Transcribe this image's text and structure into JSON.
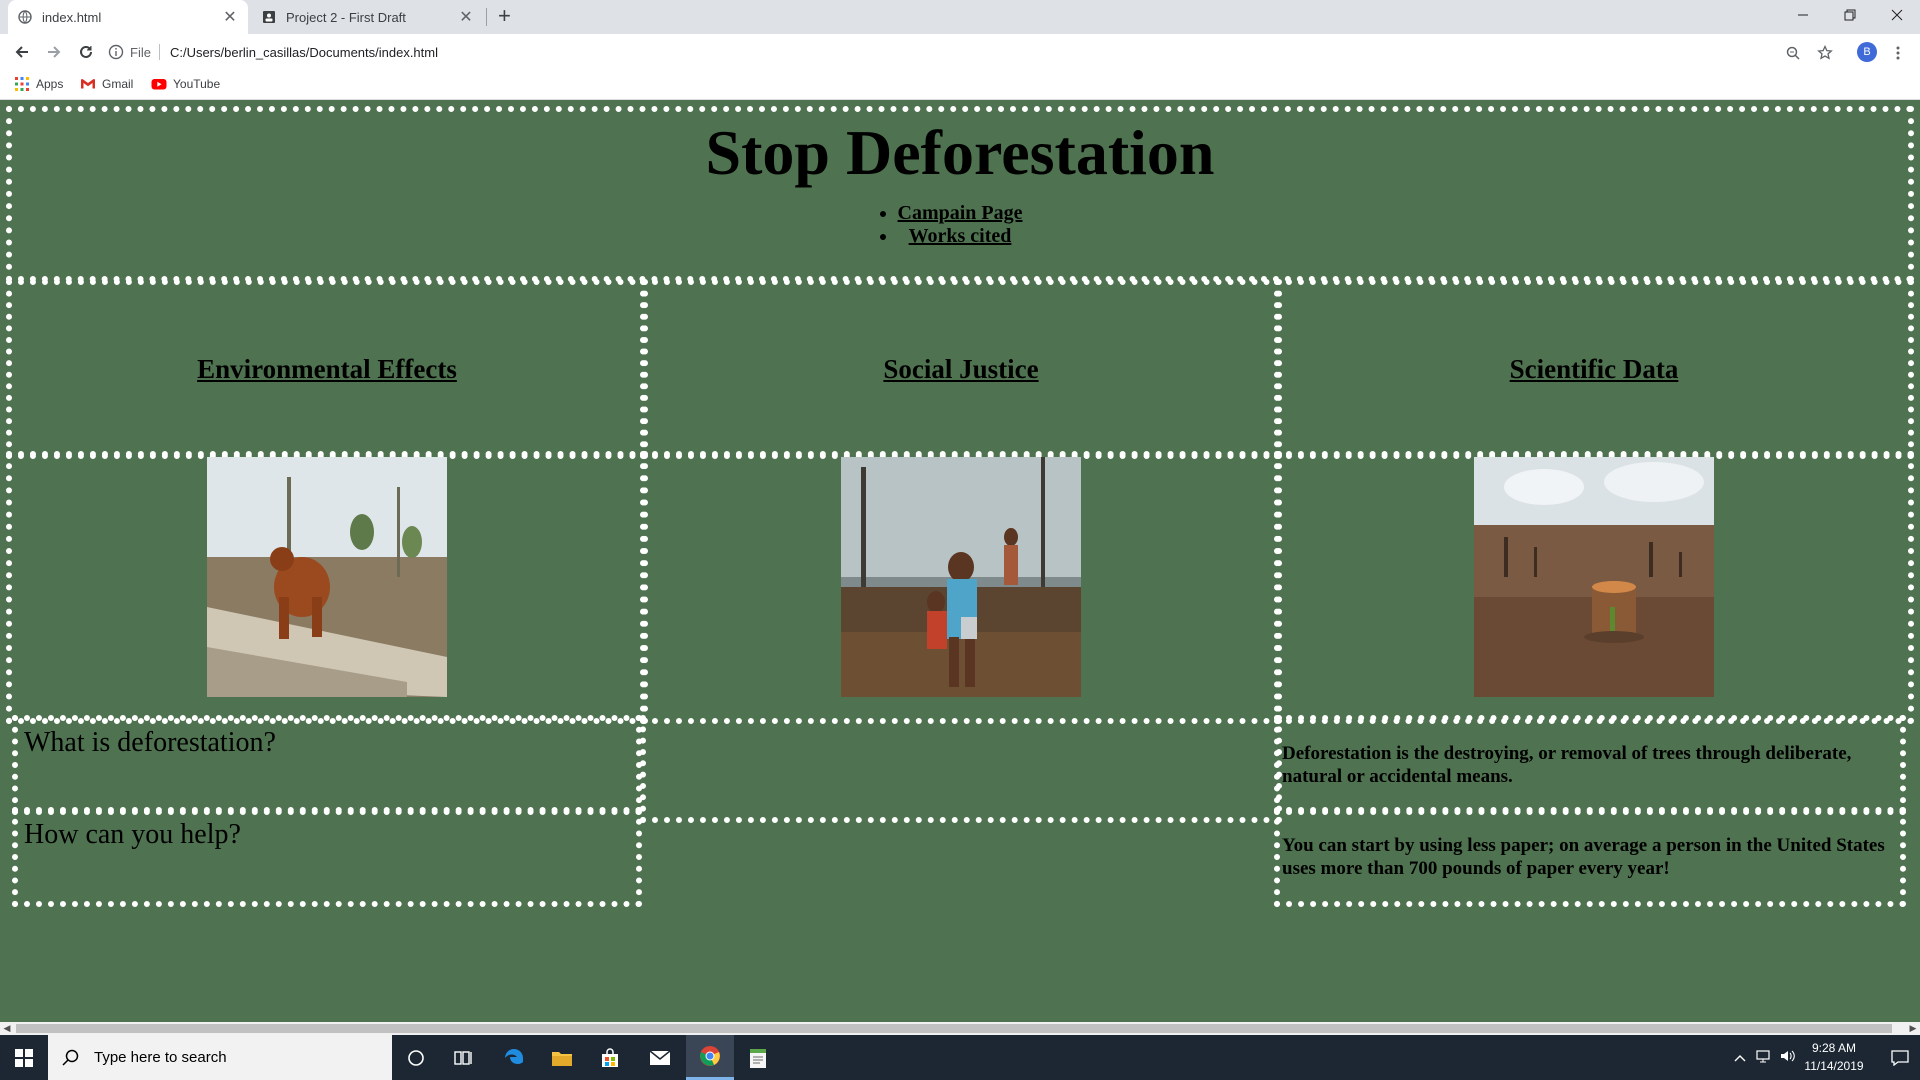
{
  "browser": {
    "tabs": [
      {
        "title": "index.html",
        "active": true
      },
      {
        "title": "Project 2 - First Draft",
        "active": false
      }
    ],
    "address": {
      "scheme": "File",
      "url": "C:/Users/berlin_casillas/Documents/index.html"
    },
    "profile_initial": "B",
    "bookmarks": [
      {
        "label": "Apps",
        "icon": "apps-grid-icon"
      },
      {
        "label": "Gmail",
        "icon": "gmail-icon"
      },
      {
        "label": "YouTube",
        "icon": "youtube-icon"
      }
    ]
  },
  "page": {
    "title": "Stop Deforestation",
    "nav_links": [
      "Campain Page",
      "Works cited"
    ],
    "sections": [
      {
        "heading": "Environmental Effects",
        "image": "orangutan-on-felled-logs"
      },
      {
        "heading": "Social Justice",
        "image": "children-in-burned-forest"
      },
      {
        "heading": "Scientific Data",
        "image": "tree-stump-in-cleared-land"
      }
    ],
    "qa": [
      {
        "question": "What is deforestation?",
        "answer": "Deforestation is the destroying, or removal of trees through deliberate, natural or accidental means."
      },
      {
        "question": "How can you help?",
        "answer": "You can start by using less paper; on average a person in the United States uses more than 700 pounds of paper every year!"
      }
    ],
    "background_color": "#4f7350",
    "border_color": "#ffffff"
  },
  "taskbar": {
    "search_placeholder": "Type here to search",
    "time": "9:28 AM",
    "date": "11/14/2019"
  }
}
